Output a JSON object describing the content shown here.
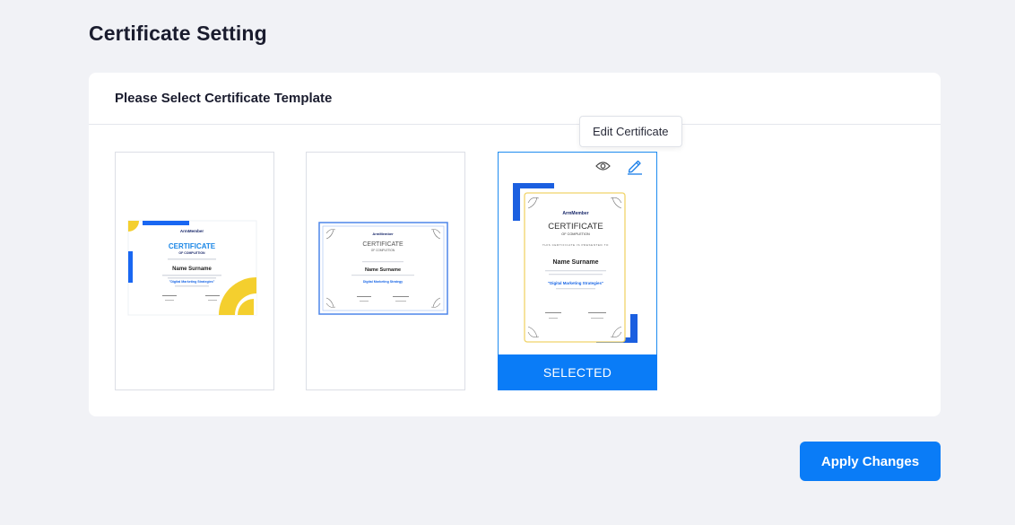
{
  "page": {
    "title": "Certificate Setting"
  },
  "card": {
    "title": "Please Select Certificate Template"
  },
  "templates": [
    {
      "brand": "ArmMember",
      "heading": "CERTIFICATE",
      "subheading": "OF COMPLETION",
      "recipient": "Name Surname",
      "course": "\"Digital Marketing Strategies\""
    },
    {
      "brand": "ArmMember",
      "heading": "CERTIFICATE",
      "subheading": "OF COMPLETION",
      "recipient": "Name Surname",
      "course": "Digital Marketing Strategy"
    },
    {
      "brand": "ArmMember",
      "heading": "CERTIFICATE",
      "subheading": "OF COMPLETION",
      "presented": "THIS CERTIFICATE IS PRESENTED TO",
      "recipient": "Name Surname",
      "course": "\"Digital Marketing Strategies\"",
      "selected_label": "SELECTED"
    }
  ],
  "tooltip": {
    "text": "Edit Certificate"
  },
  "actions": {
    "apply_label": "Apply Changes"
  },
  "icons": {
    "preview": "eye-icon",
    "edit": "pencil-icon"
  },
  "colors": {
    "primary": "#0a7cf7",
    "selected_border": "#1e8cf0",
    "accent_yellow": "#f4cf2e"
  }
}
